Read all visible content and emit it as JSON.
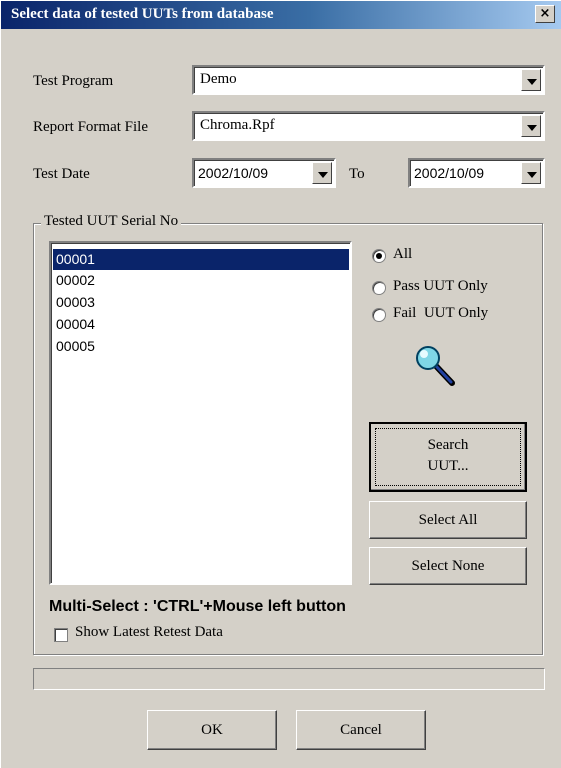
{
  "window": {
    "title": "Select data of tested UUTs from database",
    "close_symbol": "×"
  },
  "form": {
    "test_program": {
      "label": "Test Program",
      "value": "Demo"
    },
    "report_format_file": {
      "label": "Report Format File",
      "value": "Chroma.Rpf"
    },
    "test_date": {
      "label": "Test Date",
      "from": "2002/10/09",
      "to_label": "To",
      "to": "2002/10/09"
    }
  },
  "uut_group": {
    "title": "Tested UUT Serial No",
    "serials": [
      "00001",
      "00002",
      "00003",
      "00004",
      "00005"
    ],
    "selected_serial": "00001",
    "filters": {
      "all": "All",
      "pass_only": "Pass UUT Only",
      "fail_only": "Fail  UUT Only",
      "selected": "all"
    },
    "buttons": {
      "search_line1": "Search",
      "search_line2": "UUT...",
      "select_all": "Select All",
      "select_none": "Select None"
    },
    "hint": "Multi-Select : 'CTRL'+Mouse left button",
    "show_latest_retest": {
      "label": "Show Latest Retest Data",
      "checked": false
    }
  },
  "progress": {
    "value": 0
  },
  "footer": {
    "ok": "OK",
    "cancel": "Cancel"
  },
  "icons": {
    "search": "magnifier-icon",
    "dropdown": "chevron-down-icon",
    "close": "close-icon"
  },
  "colors": {
    "titlebar_start": "#0a246a",
    "titlebar_end": "#a6caf0",
    "dialog_bg": "#d4d0c8",
    "selection": "#0a246a"
  }
}
